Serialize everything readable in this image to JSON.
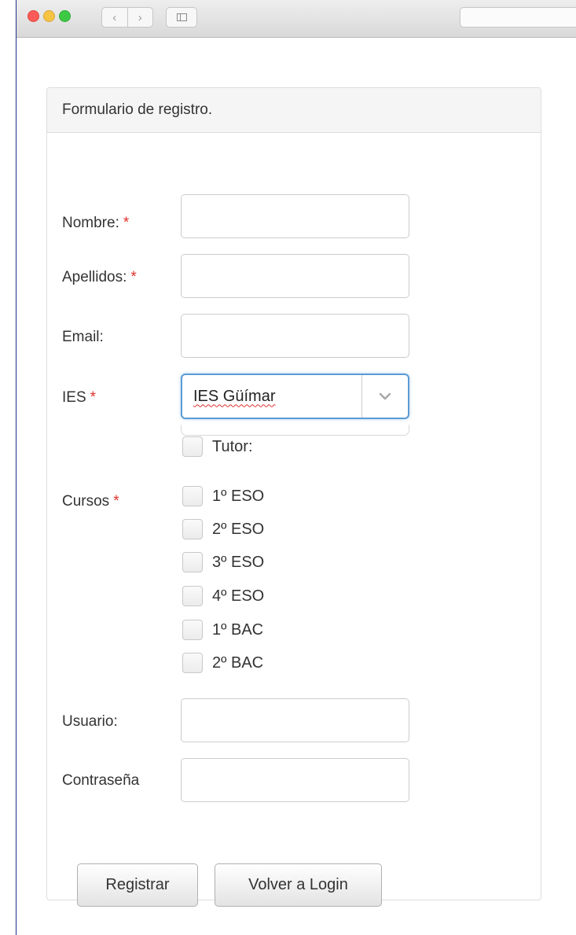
{
  "window": {
    "nav_back": "‹",
    "nav_forward": "›"
  },
  "panel": {
    "heading": "Formulario de registro."
  },
  "form": {
    "nombre_label": "Nombre:",
    "apellidos_label": "Apellidos:",
    "email_label": "Email:",
    "ies_label": "IES",
    "required_marker": "*",
    "ies_selected": "IES Güímar",
    "tutor_label": "Tutor:",
    "cursos_label": "Cursos",
    "cursos": [
      "1º ESO",
      "2º ESO",
      "3º ESO",
      "4º ESO",
      "1º BAC",
      "2º BAC"
    ],
    "usuario_label": "Usuario:",
    "password_label": "Contraseña",
    "nombre_value": "",
    "apellidos_value": "",
    "email_value": "",
    "usuario_value": "",
    "password_value": ""
  },
  "buttons": {
    "register": "Registrar",
    "back": "Volver a Login"
  },
  "colors": {
    "required": "#e0312b",
    "focus": "#5b9bd5",
    "window_border": "#1f2e8f"
  },
  "icons": {
    "select_arrow": "chevron-down-icon",
    "sidebar": "sidebar-icon"
  }
}
